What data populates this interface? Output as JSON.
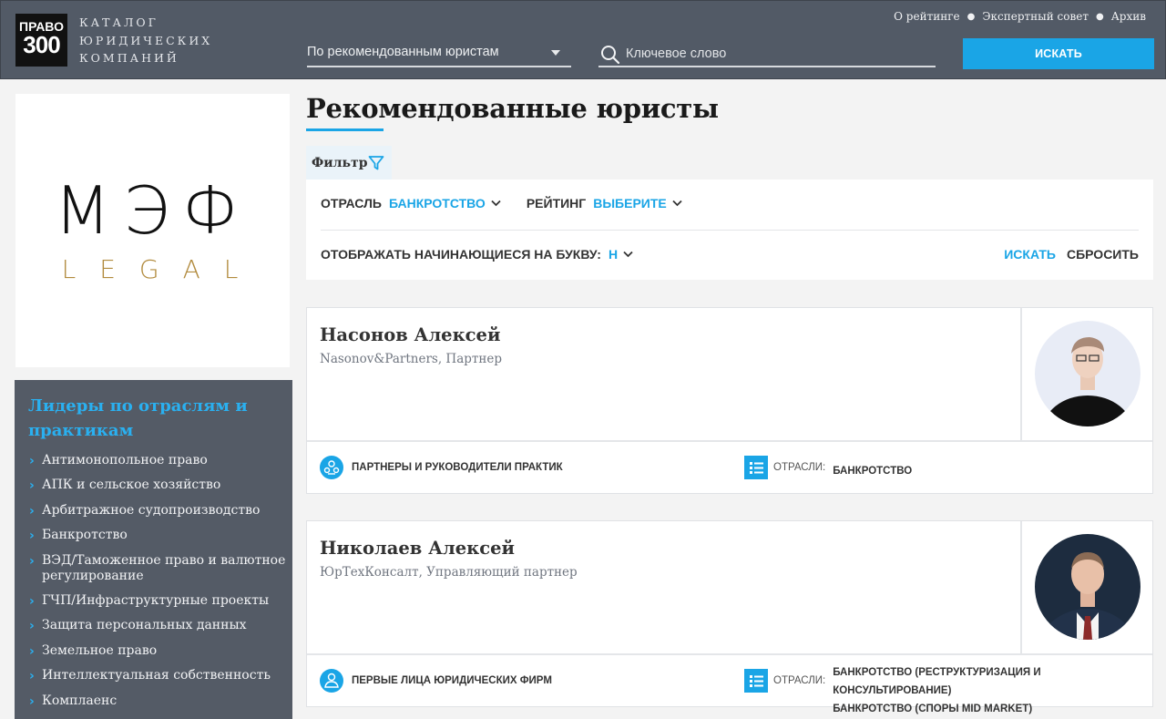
{
  "header": {
    "logo_line1": "ПРАВО",
    "logo_line2": "300",
    "catalog_line1": "КАТАЛОГ",
    "catalog_line2": "ЮРИДИЧЕСКИХ",
    "catalog_line3": "КОМПАНИЙ",
    "select_value": "По рекомендованным юристам",
    "search_placeholder": "Ключевое слово",
    "search_button": "ИСКАТЬ",
    "links": [
      "О рейтинге",
      "Экспертный совет",
      "Архив"
    ],
    "accent_color": "#1aa5e6",
    "bg_color": "#525a66"
  },
  "brand": {
    "line1": "МЭФ",
    "line2": "LEGAL",
    "gold_color": "#b28b3e"
  },
  "sidebar": {
    "title": "Лидеры по отраслям и практикам",
    "items": [
      "Антимонопольное право",
      "АПК и сельское хозяйство",
      "Арбитражное судопроизводство",
      "Банкротство",
      "ВЭД/Таможенное право и валютное регулирование",
      "ГЧП/Инфраструктурные проекты",
      "Защита персональных данных",
      "Земельное право",
      "Интеллектуальная собственность",
      "Комплаенс"
    ]
  },
  "main": {
    "title": "Рекомендованные юристы",
    "filter_tab": "Фильтр",
    "filter": {
      "industry_label": "ОТРАСЛЬ",
      "industry_value": "БАНКРОТСТВО",
      "rating_label": "РЕЙТИНГ",
      "rating_value": "ВЫБЕРИТЕ",
      "letter_label": "ОТОБРАЖАТЬ НАЧИНАЮЩИЕСЯ НА БУКВУ:",
      "letter_value": "Н",
      "search": "ИСКАТЬ",
      "reset": "СБРОСИТЬ"
    },
    "cards": [
      {
        "name": "Насонов Алексей",
        "position": "Nasonov&Partners, Партнер",
        "category": "ПАРТНЕРЫ И РУКОВОДИТЕЛИ ПРАКТИК",
        "industries_label": "ОТРАСЛИ:",
        "industries": [
          "БАНКРОТСТВО"
        ],
        "icon": "group-icon"
      },
      {
        "name": "Николаев Алексей",
        "position": "ЮрТехКонсалт, Управляющий партнер",
        "category": "ПЕРВЫЕ ЛИЦА ЮРИДИЧЕСКИХ ФИРМ",
        "industries_label": "ОТРАСЛИ:",
        "industries": [
          "БАНКРОТСТВО (РЕСТРУКТУРИЗАЦИЯ И КОНСУЛЬТИРОВАНИЕ)",
          "БАНКРОТСТВО (СПОРЫ MID MARKET)"
        ],
        "icon": "person-icon"
      }
    ]
  }
}
